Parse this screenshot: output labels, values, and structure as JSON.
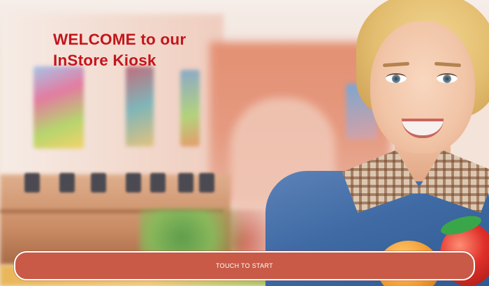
{
  "welcome": {
    "line1": "WELCOME to our",
    "line2": "InStore Kiosk"
  },
  "start_button": {
    "label": "TOUCH TO START"
  },
  "colors": {
    "title_red": "#c4151c",
    "button_bg": "#c85a47",
    "button_border": "#ffffff",
    "button_text": "#ffffff"
  }
}
